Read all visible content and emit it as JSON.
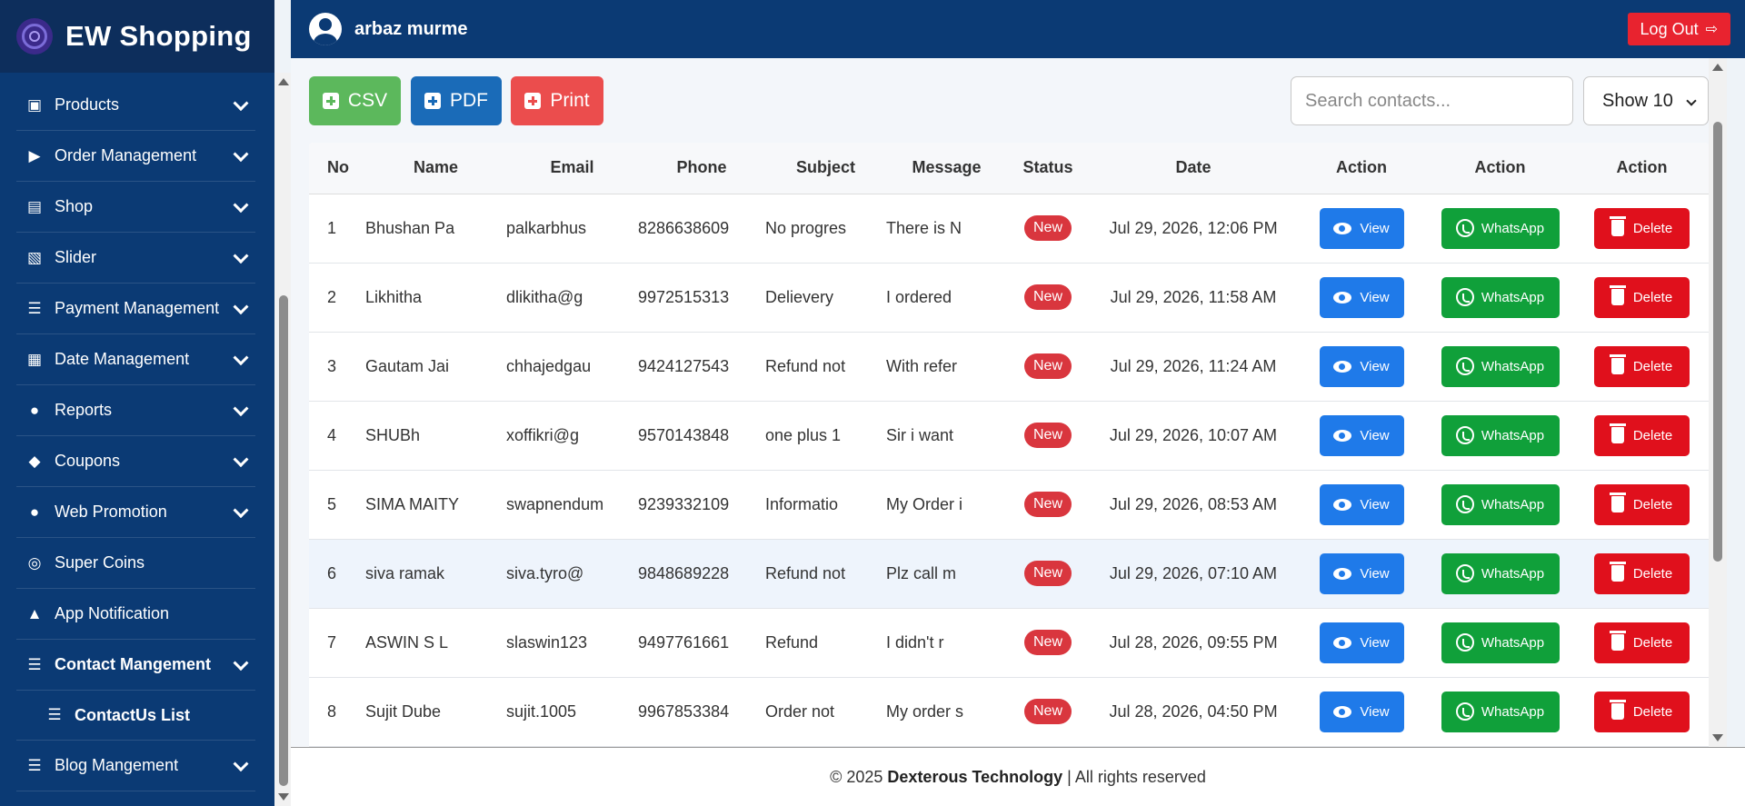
{
  "brand": {
    "name": "EW Shopping"
  },
  "header": {
    "username": "arbaz murme",
    "logout_label": "Log Out"
  },
  "sidebar": {
    "items": [
      {
        "label": "Products",
        "icon": "box-icon",
        "expandable": true
      },
      {
        "label": "Order Management",
        "icon": "truck-icon",
        "expandable": true
      },
      {
        "label": "Shop",
        "icon": "store-icon",
        "expandable": true
      },
      {
        "label": "Slider",
        "icon": "images-icon",
        "expandable": true
      },
      {
        "label": "Payment Management",
        "icon": "layers-icon",
        "expandable": true
      },
      {
        "label": "Date Management",
        "icon": "calendar-icon",
        "expandable": true
      },
      {
        "label": "Reports",
        "icon": "alert-icon",
        "expandable": true
      },
      {
        "label": "Coupons",
        "icon": "tag-icon",
        "expandable": true
      },
      {
        "label": "Web Promotion",
        "icon": "alert-icon",
        "expandable": true
      },
      {
        "label": "Super Coins",
        "icon": "coins-icon",
        "expandable": false
      },
      {
        "label": "App Notification",
        "icon": "bell-icon",
        "expandable": false
      },
      {
        "label": "Contact Mangement",
        "icon": "layers-icon",
        "expandable": true,
        "active": true
      },
      {
        "label": "ContactUs List",
        "icon": "layers-icon",
        "expandable": false,
        "sub": true
      },
      {
        "label": "Blog Mangement",
        "icon": "layers-icon",
        "expandable": true
      }
    ]
  },
  "toolbar": {
    "csv_label": "CSV",
    "pdf_label": "PDF",
    "print_label": "Print"
  },
  "search": {
    "placeholder": "Search contacts...",
    "value": ""
  },
  "page_size": {
    "selected": "Show 10"
  },
  "table": {
    "columns": [
      "No",
      "Name",
      "Email",
      "Phone",
      "Subject",
      "Message",
      "Status",
      "Date",
      "Action",
      "Action",
      "Action"
    ],
    "action_labels": {
      "view": "View",
      "whatsapp": "WhatsApp",
      "delete": "Delete"
    },
    "rows": [
      {
        "no": "1",
        "name": "Bhushan Pa",
        "email": "palkarbhus",
        "phone": "8286638609",
        "subject": "No progres",
        "message": "There is N",
        "status": "New",
        "date": "Jul 29, 2026, 12:06 PM"
      },
      {
        "no": "2",
        "name": "Likhitha",
        "email": "dlikitha@g",
        "phone": "9972515313",
        "subject": "Delievery",
        "message": "I ordered",
        "status": "New",
        "date": "Jul 29, 2026, 11:58 AM"
      },
      {
        "no": "3",
        "name": "Gautam Jai",
        "email": "chhajedgau",
        "phone": "9424127543",
        "subject": "Refund not",
        "message": "With refer",
        "status": "New",
        "date": "Jul 29, 2026, 11:24 AM"
      },
      {
        "no": "4",
        "name": "SHUBh",
        "email": "xoffikri@g",
        "phone": "9570143848",
        "subject": "one plus 1",
        "message": "Sir i want",
        "status": "New",
        "date": "Jul 29, 2026, 10:07 AM"
      },
      {
        "no": "5",
        "name": "SIMA MAITY",
        "email": "swapnendum",
        "phone": "9239332109",
        "subject": "Informatio",
        "message": "My Order i",
        "status": "New",
        "date": "Jul 29, 2026, 08:53 AM"
      },
      {
        "no": "6",
        "name": "siva ramak",
        "email": "siva.tyro@",
        "phone": "9848689228",
        "subject": "Refund not",
        "message": "Plz call m",
        "status": "New",
        "date": "Jul 29, 2026, 07:10 AM",
        "highlight": true
      },
      {
        "no": "7",
        "name": "ASWIN S L",
        "email": "slaswin123",
        "phone": "9497761661",
        "subject": "Refund",
        "message": "I didn't r",
        "status": "New",
        "date": "Jul 28, 2026, 09:55 PM"
      },
      {
        "no": "8",
        "name": "Sujit Dube",
        "email": "sujit.1005",
        "phone": "9967853384",
        "subject": "Order not",
        "message": "My order s",
        "status": "New",
        "date": "Jul 28, 2026, 04:50 PM"
      }
    ]
  },
  "footer": {
    "prefix": "© 2025",
    "company": "Dexterous Technology",
    "suffix": "| All rights reserved"
  },
  "colors": {
    "sidebar": "#0b3a74",
    "csv": "#5cb85c",
    "pdf": "#1a6bb8",
    "print": "#eb4d4d",
    "view": "#1f7ae9",
    "whatsapp": "#10a03a",
    "delete": "#e0101c",
    "badge": "#d9363e"
  }
}
